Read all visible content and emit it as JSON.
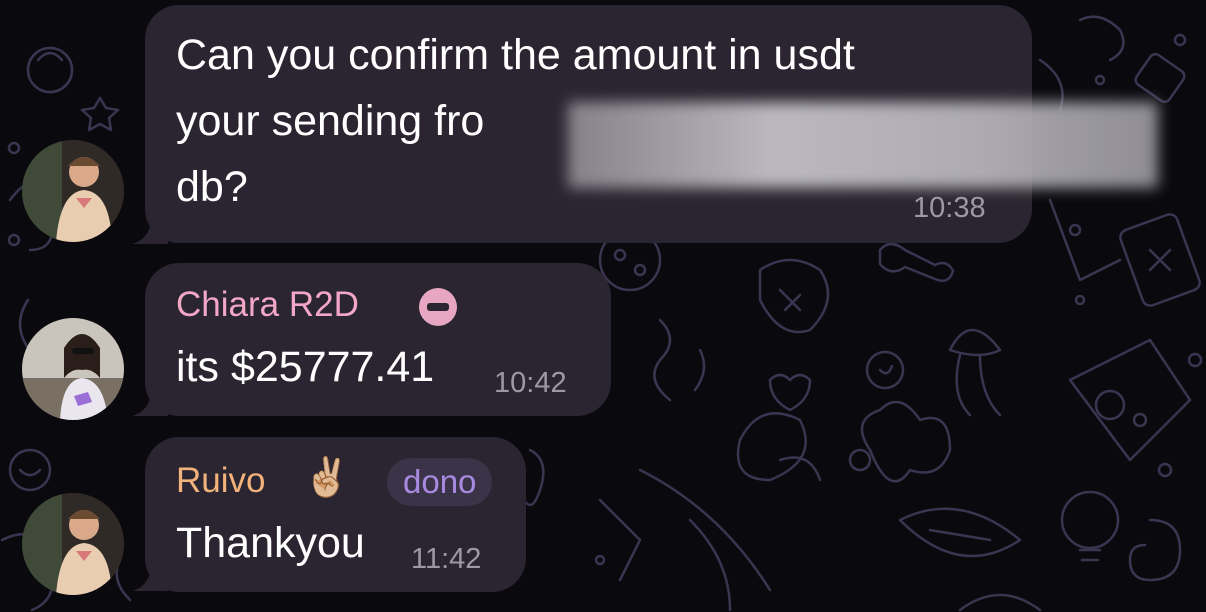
{
  "messages": [
    {
      "type": "incoming",
      "avatar": "avatar-man-1",
      "lines": [
        "Can you confirm the amount in usdt",
        "your sending fro",
        "db?"
      ],
      "time": "10:38",
      "redacted": true
    },
    {
      "type": "incoming",
      "sender": "Chiara R2D",
      "sender_color": "#f3a7c6",
      "status_icon": "minus-circle-icon",
      "avatar": "avatar-woman",
      "text": "its $25777.41",
      "time": "10:42"
    },
    {
      "type": "incoming",
      "sender": "Ruivo",
      "sender_color": "#f2b27c",
      "emoji": "✌🏼",
      "badge": "dono",
      "avatar": "avatar-man-2",
      "text": "Thankyou",
      "time": "11:42"
    }
  ],
  "colors": {
    "background": "#0a0a0e",
    "bubble": "#2a2530",
    "doodle": "#3a3550",
    "timestamp": "#9e98a6",
    "badge_text": "#a88ae0"
  }
}
